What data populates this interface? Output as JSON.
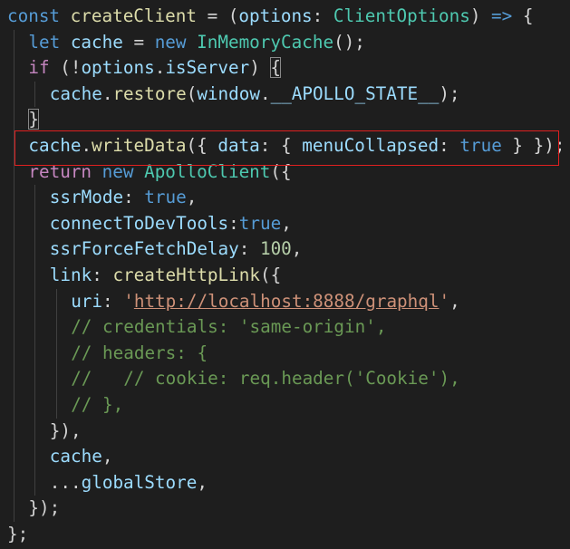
{
  "editor": {
    "language": "typescript",
    "highlight_color": "#e02020",
    "lines": [
      {
        "indent": 0,
        "tokens": [
          {
            "t": "const ",
            "c": "kw"
          },
          {
            "t": "createClient",
            "c": "fn"
          },
          {
            "t": " = (",
            "c": "punc"
          },
          {
            "t": "options",
            "c": "var"
          },
          {
            "t": ": ",
            "c": "punc"
          },
          {
            "t": "ClientOptions",
            "c": "type"
          },
          {
            "t": ") ",
            "c": "punc"
          },
          {
            "t": "=>",
            "c": "kw"
          },
          {
            "t": " {",
            "c": "punc"
          }
        ]
      },
      {
        "indent": 1,
        "tokens": [
          {
            "t": "let ",
            "c": "kw"
          },
          {
            "t": "cache",
            "c": "var"
          },
          {
            "t": " = ",
            "c": "punc"
          },
          {
            "t": "new ",
            "c": "kw"
          },
          {
            "t": "InMemoryCache",
            "c": "type"
          },
          {
            "t": "();",
            "c": "punc"
          }
        ]
      },
      {
        "indent": 1,
        "tokens": [
          {
            "t": "if",
            "c": "ctrl"
          },
          {
            "t": " (!",
            "c": "punc"
          },
          {
            "t": "options",
            "c": "var"
          },
          {
            "t": ".",
            "c": "punc"
          },
          {
            "t": "isServer",
            "c": "var"
          },
          {
            "t": ") ",
            "c": "punc"
          },
          {
            "t": "{",
            "c": "brk"
          }
        ]
      },
      {
        "indent": 2,
        "tokens": [
          {
            "t": "cache",
            "c": "var"
          },
          {
            "t": ".",
            "c": "punc"
          },
          {
            "t": "restore",
            "c": "fn"
          },
          {
            "t": "(",
            "c": "punc"
          },
          {
            "t": "window",
            "c": "var"
          },
          {
            "t": ".",
            "c": "punc"
          },
          {
            "t": "__APOLLO_STATE__",
            "c": "var"
          },
          {
            "t": ");",
            "c": "punc"
          }
        ]
      },
      {
        "indent": 1,
        "tokens": [
          {
            "t": "}",
            "c": "brk"
          }
        ]
      },
      {
        "indent": 1,
        "tokens": [
          {
            "t": "cache",
            "c": "var"
          },
          {
            "t": ".",
            "c": "punc"
          },
          {
            "t": "writeData",
            "c": "fn"
          },
          {
            "t": "({ ",
            "c": "punc"
          },
          {
            "t": "data",
            "c": "var"
          },
          {
            "t": ": { ",
            "c": "punc"
          },
          {
            "t": "menuCollapsed",
            "c": "var"
          },
          {
            "t": ": ",
            "c": "punc"
          },
          {
            "t": "true",
            "c": "kw"
          },
          {
            "t": " } });",
            "c": "punc"
          }
        ]
      },
      {
        "indent": 1,
        "tokens": [
          {
            "t": "return",
            "c": "ctrl"
          },
          {
            "t": " ",
            "c": "punc"
          },
          {
            "t": "new ",
            "c": "kw"
          },
          {
            "t": "ApolloClient",
            "c": "type"
          },
          {
            "t": "({",
            "c": "punc"
          }
        ]
      },
      {
        "indent": 2,
        "tokens": [
          {
            "t": "ssrMode",
            "c": "var"
          },
          {
            "t": ": ",
            "c": "punc"
          },
          {
            "t": "true",
            "c": "kw"
          },
          {
            "t": ",",
            "c": "punc"
          }
        ]
      },
      {
        "indent": 2,
        "tokens": [
          {
            "t": "connectToDevTools",
            "c": "var"
          },
          {
            "t": ":",
            "c": "punc"
          },
          {
            "t": "true",
            "c": "kw"
          },
          {
            "t": ",",
            "c": "punc"
          }
        ]
      },
      {
        "indent": 2,
        "tokens": [
          {
            "t": "ssrForceFetchDelay",
            "c": "var"
          },
          {
            "t": ": ",
            "c": "punc"
          },
          {
            "t": "100",
            "c": "num"
          },
          {
            "t": ",",
            "c": "punc"
          }
        ]
      },
      {
        "indent": 2,
        "tokens": [
          {
            "t": "link",
            "c": "var"
          },
          {
            "t": ": ",
            "c": "punc"
          },
          {
            "t": "createHttpLink",
            "c": "fn"
          },
          {
            "t": "({",
            "c": "punc"
          }
        ]
      },
      {
        "indent": 3,
        "tokens": [
          {
            "t": "uri",
            "c": "var"
          },
          {
            "t": ": ",
            "c": "punc"
          },
          {
            "t": "'",
            "c": "str"
          },
          {
            "t": "http://localhost:8888/graphql",
            "c": "url"
          },
          {
            "t": "'",
            "c": "str"
          },
          {
            "t": ",",
            "c": "punc"
          }
        ]
      },
      {
        "indent": 3,
        "tokens": [
          {
            "t": "// credentials: 'same-origin',",
            "c": "com"
          }
        ]
      },
      {
        "indent": 3,
        "tokens": [
          {
            "t": "// headers: {",
            "c": "com"
          }
        ]
      },
      {
        "indent": 3,
        "tokens": [
          {
            "t": "//   // cookie: req.header('Cookie'),",
            "c": "com"
          }
        ]
      },
      {
        "indent": 3,
        "tokens": [
          {
            "t": "// },",
            "c": "com"
          }
        ]
      },
      {
        "indent": 2,
        "tokens": [
          {
            "t": "}),",
            "c": "punc"
          }
        ]
      },
      {
        "indent": 2,
        "tokens": [
          {
            "t": "cache",
            "c": "var"
          },
          {
            "t": ",",
            "c": "punc"
          }
        ]
      },
      {
        "indent": 2,
        "tokens": [
          {
            "t": "...",
            "c": "punc"
          },
          {
            "t": "globalStore",
            "c": "var"
          },
          {
            "t": ",",
            "c": "punc"
          }
        ]
      },
      {
        "indent": 1,
        "tokens": [
          {
            "t": "});",
            "c": "punc"
          }
        ]
      },
      {
        "indent": 0,
        "tokens": [
          {
            "t": "};",
            "c": "punc"
          }
        ]
      }
    ]
  }
}
